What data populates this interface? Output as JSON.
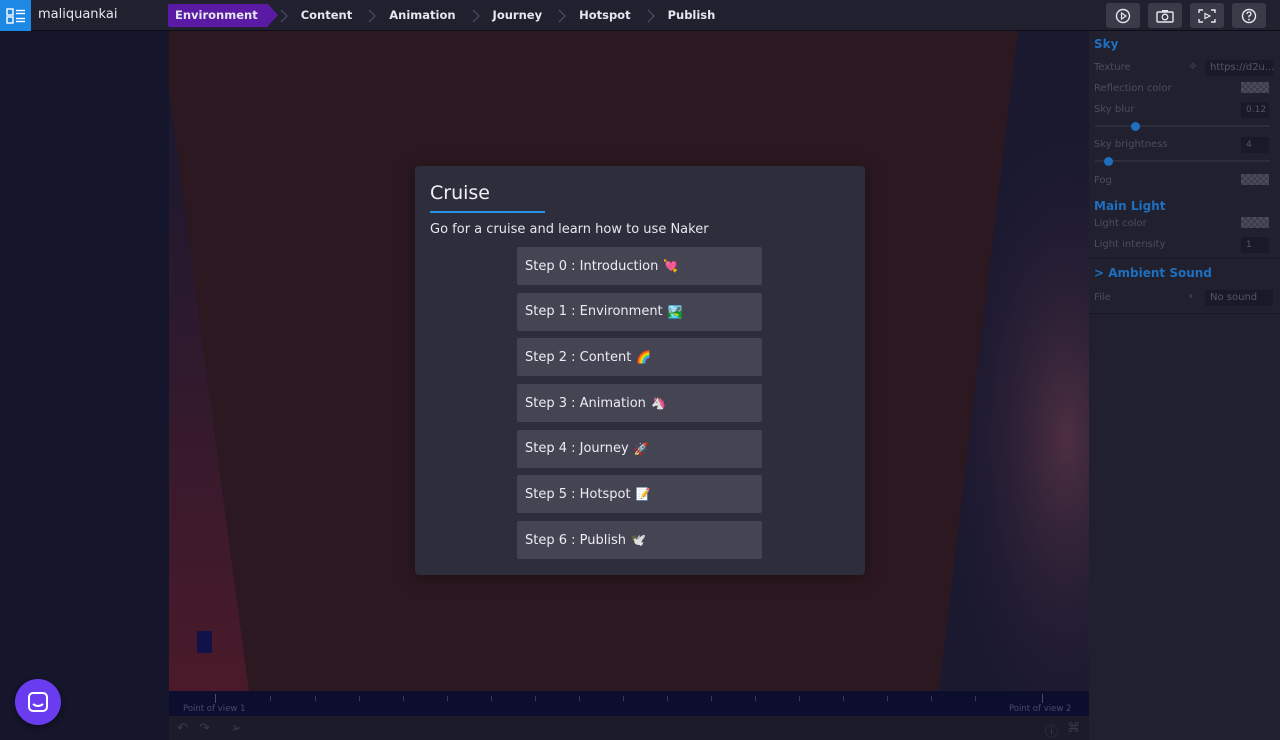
{
  "app": {
    "title": "maliquankai"
  },
  "breadcrumbs": [
    {
      "label": "Environment",
      "active": true
    },
    {
      "label": "Content"
    },
    {
      "label": "Animation"
    },
    {
      "label": "Journey"
    },
    {
      "label": "Hotspot"
    },
    {
      "label": "Publish"
    }
  ],
  "toolbar": {
    "icons": [
      "play-circle-icon",
      "camera-icon",
      "fullscreen-icon",
      "help-icon"
    ]
  },
  "modal": {
    "title": "Cruise",
    "description": "Go for a cruise and learn how to use Naker",
    "steps": [
      {
        "label": "Step 0 : Introduction",
        "emoji": "💘"
      },
      {
        "label": "Step 1 : Environment",
        "emoji": "🏞️"
      },
      {
        "label": "Step 2 : Content",
        "emoji": "🌈"
      },
      {
        "label": "Step 3 : Animation",
        "emoji": "🦄"
      },
      {
        "label": "Step 4 : Journey",
        "emoji": "🚀"
      },
      {
        "label": "Step 5 : Hotspot",
        "emoji": "📝"
      },
      {
        "label": "Step 6 : Publish",
        "emoji": "🕊️"
      }
    ]
  },
  "panel": {
    "sky": {
      "title": "Sky",
      "texture_label": "Texture",
      "texture_value": "https://d2u...",
      "reflection_label": "Reflection color",
      "blur_label": "Sky blur",
      "blur_value": "0.12",
      "blur_level": 0.12,
      "brightness_label": "Sky brightness",
      "brightness_value": "4",
      "brightness_level": 0.04,
      "fog_label": "Fog"
    },
    "main_light": {
      "title": "Main Light",
      "color_label": "Light color",
      "intensity_label": "Light intensity",
      "intensity_value": "1"
    },
    "ambient_sound": {
      "title": "> Ambient Sound",
      "file_label": "File",
      "file_value": "No sound"
    }
  },
  "timeline": {
    "start_label": "Point of view 1",
    "end_label": "Point of view 2"
  },
  "colors": {
    "accent": "#1e88e5",
    "active_crumb": "#5a1aa3",
    "chat": "#6a3cf0"
  }
}
